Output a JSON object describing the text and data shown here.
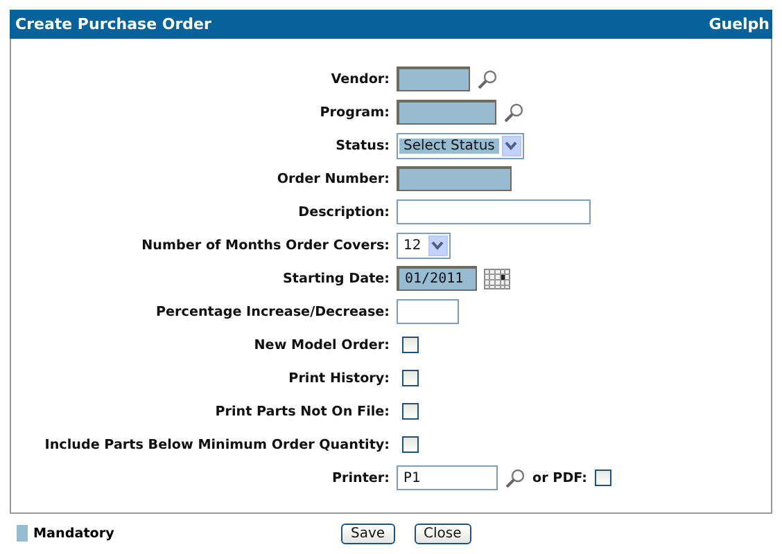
{
  "header": {
    "title": "Create Purchase Order",
    "location": "Guelph"
  },
  "fields": [
    {
      "kind": "text",
      "label": "Vendor:",
      "mandatory": true,
      "lookup": true
    },
    {
      "kind": "text",
      "label": "Program:",
      "mandatory": true,
      "lookup": true
    },
    {
      "kind": "select",
      "label": "Status:",
      "value": "Select Status",
      "mandatory": true
    },
    {
      "kind": "text",
      "label": "Order Number:",
      "mandatory": true,
      "lookup": false
    },
    {
      "kind": "text",
      "label": "Description:",
      "mandatory": false,
      "lookup": false
    },
    {
      "kind": "select",
      "label": "Number of Months Order Covers:",
      "value": "12",
      "mandatory": false
    },
    {
      "kind": "date",
      "label": "Starting Date:",
      "value": "01/2011",
      "mandatory": true
    },
    {
      "kind": "text",
      "label": "Percentage Increase/Decrease:",
      "mandatory": false,
      "lookup": false
    },
    {
      "kind": "checkbox",
      "label": "New Model Order:",
      "checked": false
    },
    {
      "kind": "checkbox",
      "label": "Print History:",
      "checked": false
    },
    {
      "kind": "checkbox",
      "label": "Print Parts Not On File:",
      "checked": false
    },
    {
      "kind": "checkbox",
      "label": "Include Parts Below Minimum Order Quantity:",
      "checked": false
    },
    {
      "kind": "printer",
      "label": "Printer:",
      "value": "P1",
      "mandatory": false,
      "pdf_label": "or PDF:",
      "pdf_checked": false
    }
  ],
  "legend": {
    "label": "Mandatory"
  },
  "buttons": [
    "Save",
    "Close"
  ]
}
